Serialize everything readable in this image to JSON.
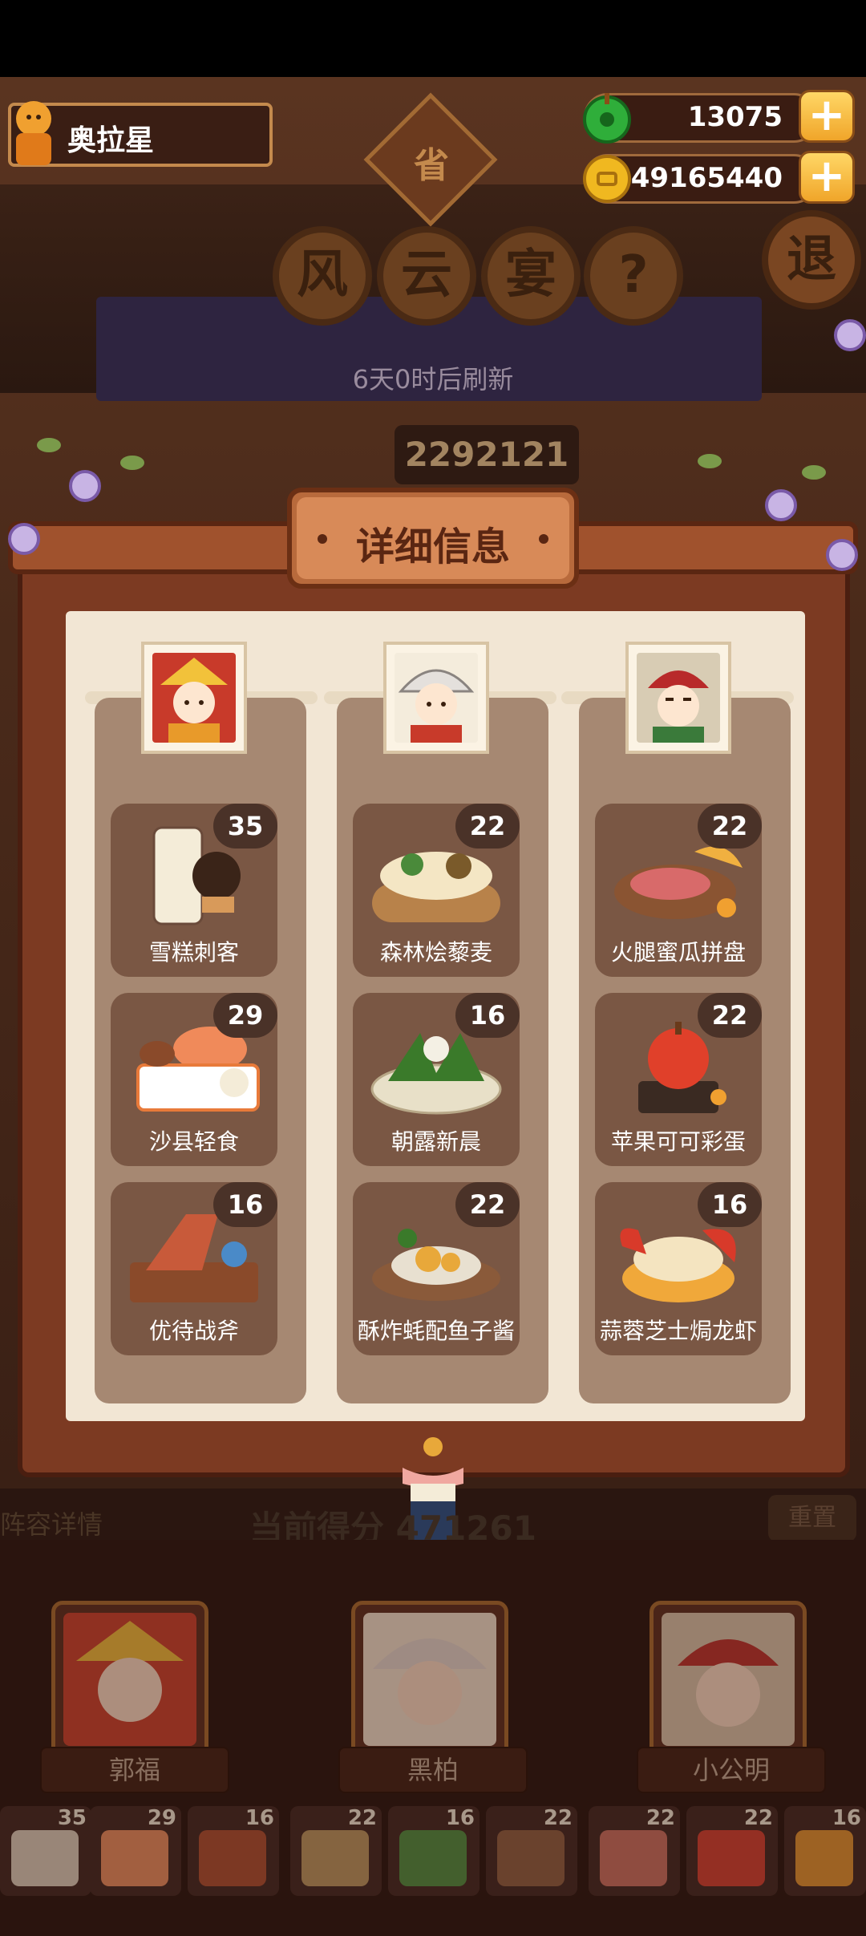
{
  "player": {
    "name": "奥拉星"
  },
  "currency": {
    "jade": {
      "value": "13075",
      "icon": "jade-icon",
      "color": "#2fae3a"
    },
    "coin": {
      "value": "49165440",
      "icon": "coin-icon",
      "color": "#f0b820"
    },
    "plus_label": "+"
  },
  "header": {
    "province_badge": "省",
    "title_chars": [
      "风",
      "云",
      "宴"
    ],
    "help_label": "?",
    "exit_label": "退",
    "refresh_text": "6天0时后刷新",
    "score_top": "2292121"
  },
  "modal": {
    "title": "详细信息",
    "columns": [
      {
        "chef": "郭福",
        "dishes": [
          {
            "name": "雪糕刺客",
            "count": "35"
          },
          {
            "name": "沙县轻食",
            "count": "29"
          },
          {
            "name": "优待战斧",
            "count": "16"
          }
        ]
      },
      {
        "chef": "黑柏",
        "dishes": [
          {
            "name": "森林烩藜麦",
            "count": "22"
          },
          {
            "name": "朝露新晨",
            "count": "16"
          },
          {
            "name": "酥炸蚝配鱼子酱",
            "count": "22"
          }
        ]
      },
      {
        "chef": "小公明",
        "dishes": [
          {
            "name": "火腿蜜瓜拼盘",
            "count": "22"
          },
          {
            "name": "苹果可可彩蛋",
            "count": "22"
          },
          {
            "name": "蒜蓉芝士焗龙虾",
            "count": "16"
          }
        ]
      }
    ]
  },
  "background": {
    "lineup_label": "阵容详情",
    "current_score_label": "当前得分",
    "current_score_value": "471261",
    "reset_label": "重置"
  },
  "chefs": [
    {
      "name": "郭福"
    },
    {
      "name": "黑柏"
    },
    {
      "name": "小公明"
    }
  ],
  "dish_strip": [
    "35",
    "29",
    "16",
    "22",
    "16",
    "22",
    "22",
    "22",
    "16"
  ]
}
